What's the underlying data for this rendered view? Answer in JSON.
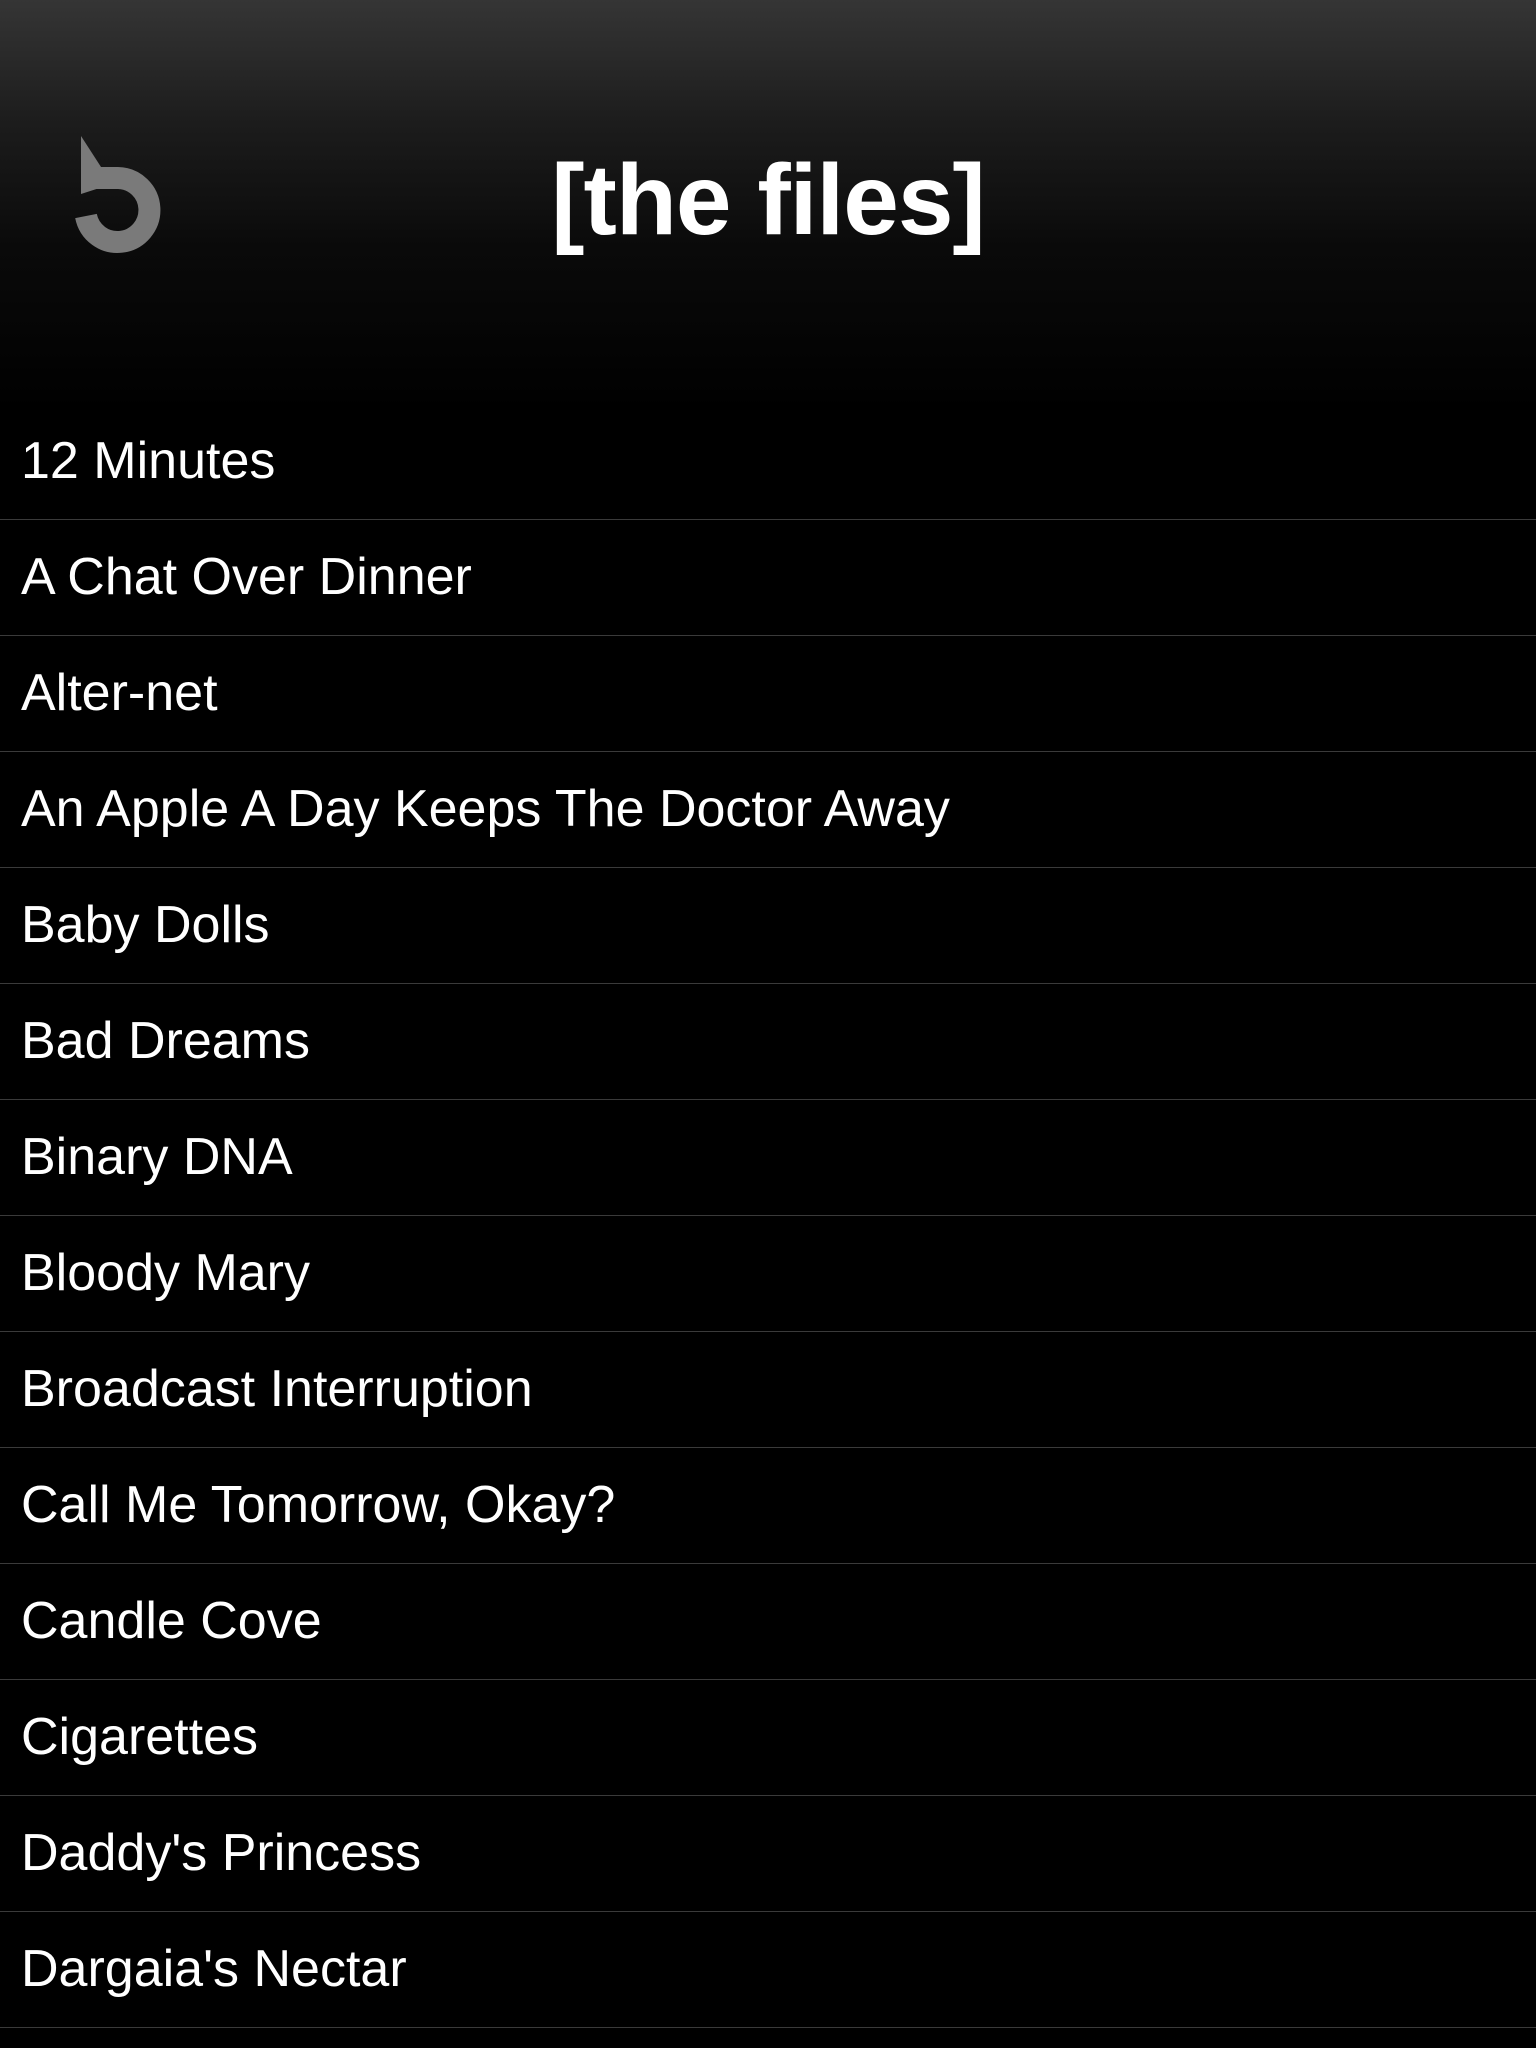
{
  "header": {
    "title": "[the files]",
    "back_icon": "undo-arrow-icon"
  },
  "files": [
    {
      "label": "12 Minutes"
    },
    {
      "label": "A Chat Over Dinner"
    },
    {
      "label": "Alter-net"
    },
    {
      "label": "An Apple A Day Keeps The Doctor Away"
    },
    {
      "label": "Baby Dolls"
    },
    {
      "label": "Bad Dreams"
    },
    {
      "label": "Binary DNA"
    },
    {
      "label": "Bloody Mary"
    },
    {
      "label": "Broadcast Interruption"
    },
    {
      "label": "Call Me Tomorrow, Okay?"
    },
    {
      "label": "Candle Cove"
    },
    {
      "label": "Cigarettes"
    },
    {
      "label": "Daddy's Princess"
    },
    {
      "label": "Dargaia's Nectar"
    }
  ],
  "colors": {
    "background": "#000000",
    "text": "#ffffff",
    "icon": "#7a7a7a",
    "divider": "#3a3a3a"
  }
}
